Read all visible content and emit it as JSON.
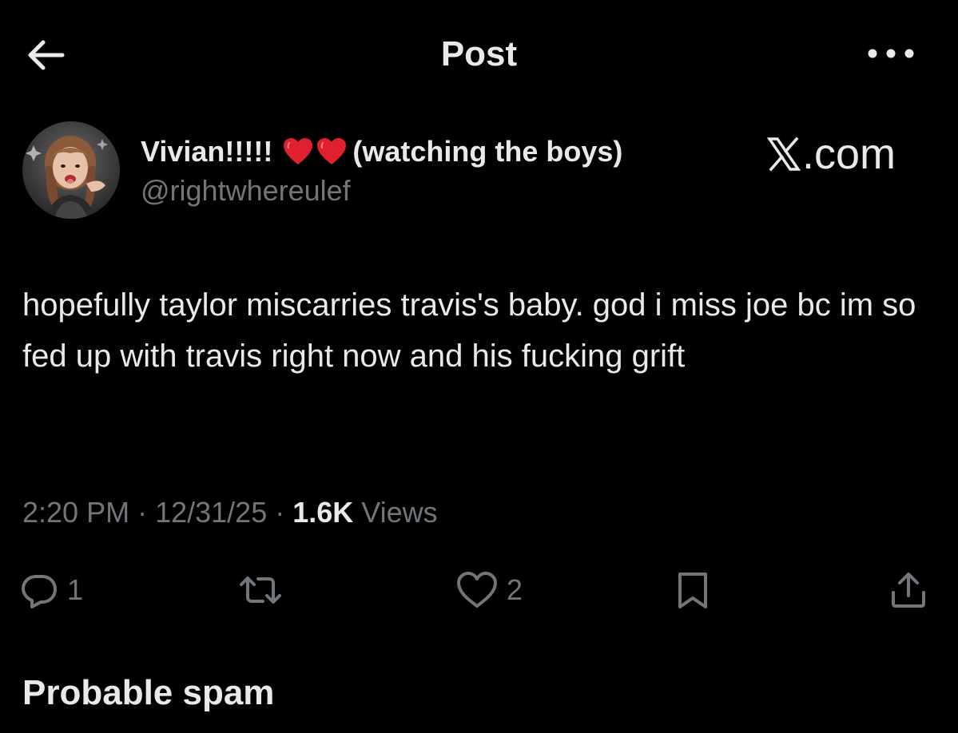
{
  "header": {
    "title": "Post",
    "back_icon": "arrow-left-icon",
    "more_icon": "more-horizontal-icon"
  },
  "author": {
    "display_name_prefix": "Vivian!!!!!",
    "display_name_suffix": "(watching the boys)",
    "emoji": [
      "red-heart-icon",
      "red-heart-icon"
    ],
    "handle": "@rightwhereulef"
  },
  "watermark": {
    "logo_icon": "x-logo-icon",
    "text": ".com"
  },
  "post": {
    "text": "hopefully taylor miscarries travis's baby. god i miss joe bc im so fed up with travis right now and his fucking grift"
  },
  "meta": {
    "time": "2:20 PM",
    "sep1": " · ",
    "date": "12/31/25",
    "sep2": " · ",
    "views_count": "1.6K",
    "views_label": " Views"
  },
  "actions": {
    "reply": {
      "icon": "reply-icon",
      "count": "1"
    },
    "repost": {
      "icon": "repost-icon",
      "count": ""
    },
    "like": {
      "icon": "heart-icon",
      "count": "2"
    },
    "bookmark": {
      "icon": "bookmark-icon",
      "count": ""
    },
    "share": {
      "icon": "share-icon",
      "count": ""
    }
  },
  "footer": {
    "label": "Probable spam"
  },
  "colors": {
    "background": "#000000",
    "primary_text": "#e7e9ea",
    "secondary_text": "#71767b",
    "heart_red": "#e0202e"
  }
}
